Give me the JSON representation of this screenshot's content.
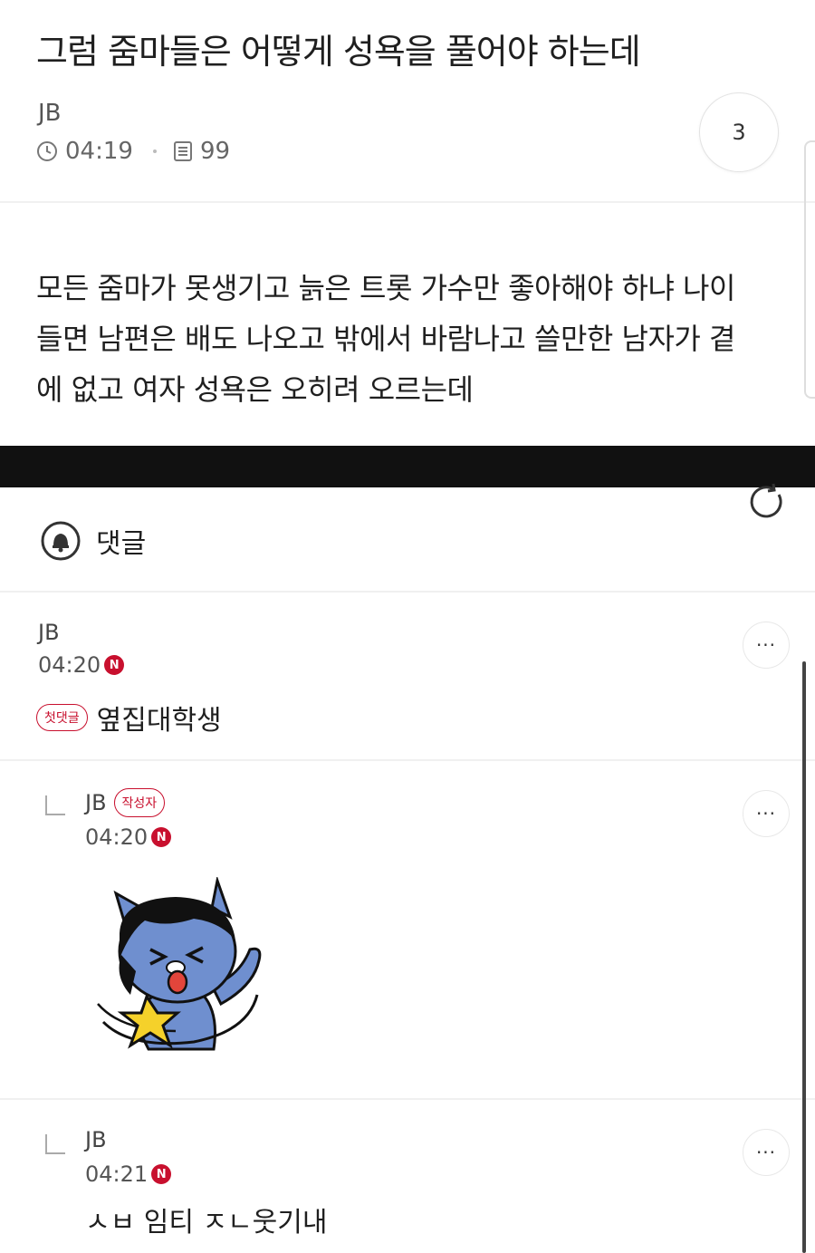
{
  "post": {
    "title": "그럼 줌마들은 어떻게 성욕을 풀어야 하는데",
    "author": "JB",
    "time": "04:19",
    "views": "99",
    "comment_count": "3",
    "body_lines": [
      "모든 줌마가 못생기고 늙은 트롯 가수만 좋아해야 하냐 나이",
      "들면 남편은 배도 나오고 밖에서 바람나고 쓸만한 남자가 곁",
      "에 없고 여자 성욕은 오히려 오르는데"
    ]
  },
  "comments_section": {
    "label": "댓글"
  },
  "comments": [
    {
      "author": "JB",
      "time": "04:20",
      "new_badge": "N",
      "first_badge": "첫댓글",
      "text": "옆집대학생",
      "more": "···"
    },
    {
      "author": "JB",
      "writer_badge": "작성자",
      "time": "04:20",
      "new_badge": "N",
      "sticker": "cat-sticker",
      "more": "···"
    },
    {
      "author": "JB",
      "time": "04:21",
      "new_badge": "N",
      "text": "ㅅㅂ 임티 ㅈㄴ웃기내",
      "more": "···"
    }
  ],
  "colors": {
    "accent": "#c8102e",
    "band": "#111111"
  }
}
